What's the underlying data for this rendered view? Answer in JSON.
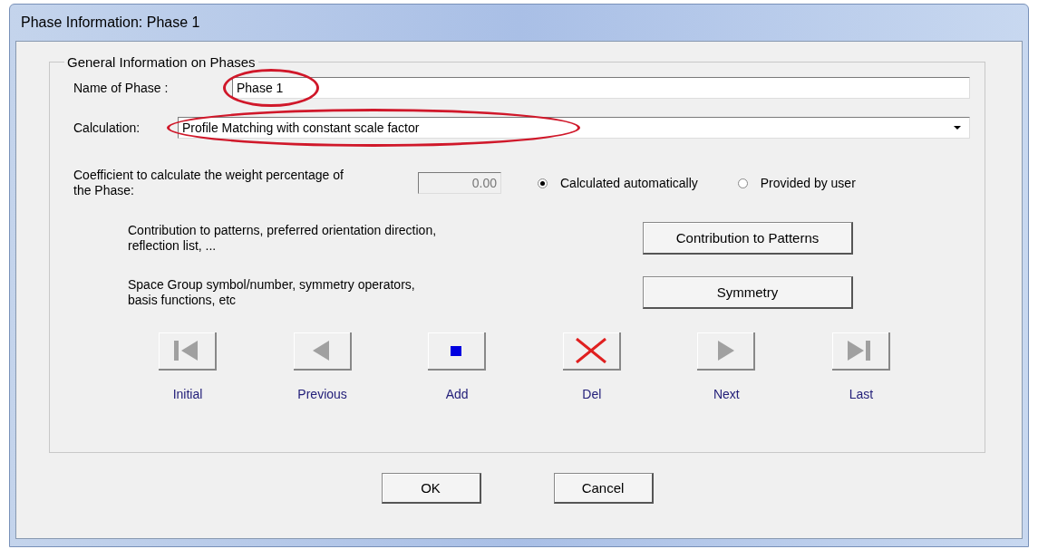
{
  "window": {
    "title": "Phase Information: Phase 1"
  },
  "group": {
    "title": "General Information on Phases"
  },
  "name_field": {
    "label": "Name of Phase :",
    "value": "Phase 1",
    "highlighted": true
  },
  "calculation": {
    "label": "Calculation:",
    "value": "Profile Matching with constant scale factor",
    "highlighted": true
  },
  "coefficient": {
    "label": "Coefficient to calculate the weight percentage of the Phase:",
    "value": "0.00",
    "disabled": true,
    "options": [
      {
        "label": "Calculated automatically",
        "selected": true
      },
      {
        "label": "Provided by user",
        "selected": false
      }
    ]
  },
  "actions": [
    {
      "description": "Contribution to patterns, preferred orientation direction, reflection list, ...",
      "button": "Contribution to Patterns"
    },
    {
      "description": "Space Group symbol/number, symmetry operators, basis functions, etc",
      "button": "Symmetry"
    }
  ],
  "navigation": [
    {
      "kind": "first",
      "label": "Initial"
    },
    {
      "kind": "previous",
      "label": "Previous"
    },
    {
      "kind": "add",
      "label": "Add"
    },
    {
      "kind": "delete",
      "label": "Del"
    },
    {
      "kind": "next",
      "label": "Next"
    },
    {
      "kind": "last",
      "label": "Last"
    }
  ],
  "buttons": [
    "OK",
    "Cancel"
  ]
}
